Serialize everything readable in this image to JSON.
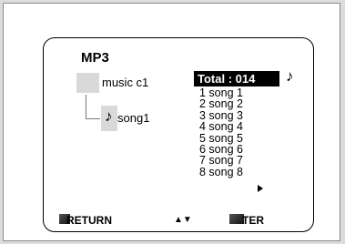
{
  "panel": {
    "heading": "MP3",
    "folder": {
      "label": "music c1",
      "icon": "folder-icon"
    },
    "file": {
      "label": "song1",
      "icon": "music-note-icon"
    }
  },
  "track_list": {
    "total_label": "Total : 014",
    "note_symbol": "♪",
    "items": [
      "1 song 1",
      "2 song 2",
      "3 song 3",
      "4 song 4",
      "5 song 5",
      "6 song 6",
      "7 song 7",
      "8 song 8"
    ]
  },
  "footer": {
    "return_label": "RETURN",
    "nav_label": "▲▼",
    "enter_label": "TER"
  },
  "colors": {
    "background": "#dcdcdc",
    "highlight": "#000000",
    "item_fill": "#d9d9d9"
  }
}
